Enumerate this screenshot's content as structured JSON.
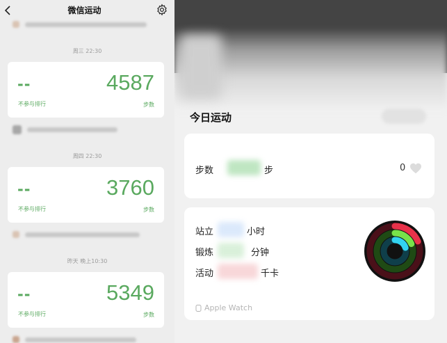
{
  "left": {
    "nav_title": "微信运动",
    "entries": [
      {
        "time": "周三 22:30",
        "rank_value": "--",
        "steps": "4587",
        "rank_label": "不参与排行",
        "unit": "步数"
      },
      {
        "time": "周四 22:30",
        "rank_value": "--",
        "steps": "3760",
        "rank_label": "不参与排行",
        "unit": "步数"
      },
      {
        "time": "昨天 晚上10:30",
        "rank_value": "--",
        "steps": "5349",
        "rank_label": "不参与排行",
        "unit": "步数"
      }
    ]
  },
  "right": {
    "section_title": "今日运动",
    "steps_label": "步数",
    "steps_unit": "步",
    "like_count": "0",
    "metrics": [
      {
        "label": "站立",
        "unit": "小时",
        "color": "#dbe9fb"
      },
      {
        "label": "锻炼",
        "unit": "分钟",
        "color": "#d9f0da"
      },
      {
        "label": "活动",
        "unit": "千卡",
        "color": "#f8d7d9"
      }
    ],
    "device": "Apple Watch",
    "ring_colors": {
      "move": "#e8324a",
      "exercise": "#78e24a",
      "stand": "#32d3f0"
    }
  }
}
